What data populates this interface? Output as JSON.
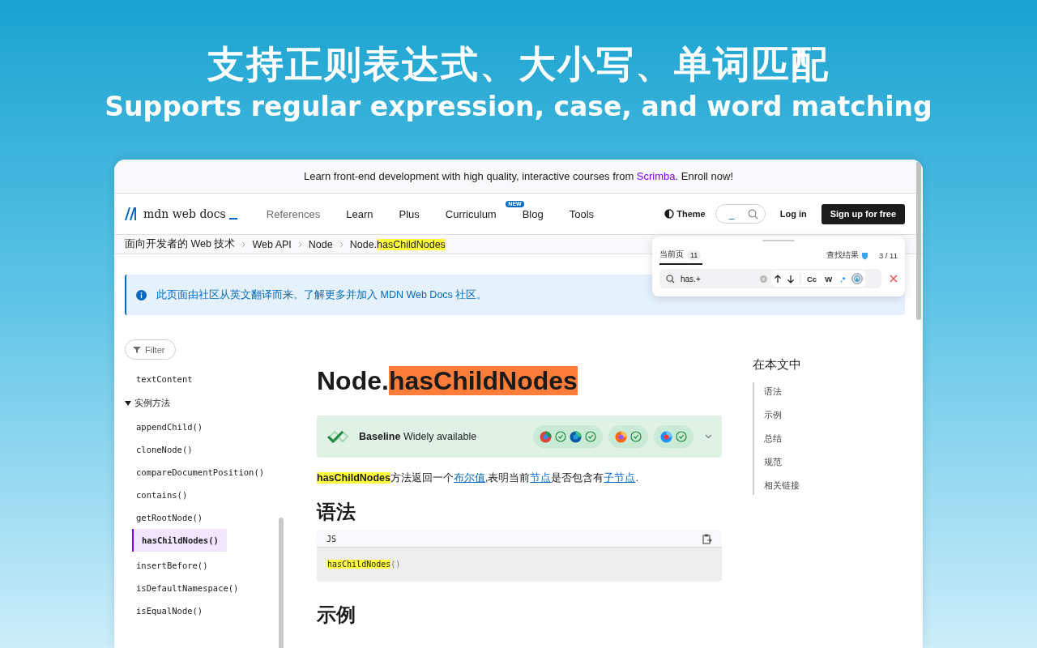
{
  "headline": {
    "title": "支持正则表达式、大小写、单词匹配",
    "subtitle": "Supports regular expression, case, and word matching"
  },
  "banner": {
    "before": "Learn front-end development with high quality, interactive courses from ",
    "link": "Scrimba",
    "after": ". Enroll now!"
  },
  "nav": {
    "logo": "mdn web docs",
    "links": [
      {
        "label": "References",
        "selected": true
      },
      {
        "label": "Learn",
        "selected": false
      },
      {
        "label": "Plus",
        "selected": false
      },
      {
        "label": "Curriculum",
        "selected": false,
        "badge": "NEW"
      },
      {
        "label": "Blog",
        "selected": false
      },
      {
        "label": "Tools",
        "selected": false
      }
    ],
    "theme": "Theme",
    "search_placeholder": "_",
    "login": "Log in",
    "signup": "Sign up for free"
  },
  "breadcrumbs": [
    {
      "text": "面向开发者的 Web 技术"
    },
    {
      "text": "Web API"
    },
    {
      "text": "Node"
    },
    {
      "text": "Node.",
      "match": "hasChildNodes"
    }
  ],
  "notice": "此页面由社区从英文翻译而来。了解更多并加入 MDN Web Docs 社区。",
  "sidebar": {
    "filter": "Filter",
    "items": [
      {
        "label": "textContent",
        "selected": false
      },
      {
        "label": "实例方法",
        "expanded": true,
        "children": [
          {
            "label": "appendChild()",
            "selected": false
          },
          {
            "label": "cloneNode()",
            "selected": false
          },
          {
            "label": "compareDocumentPosition()",
            "selected": false
          },
          {
            "label": "contains()",
            "selected": false
          },
          {
            "label": "getRootNode()",
            "selected": false
          },
          {
            "label": "hasChildNodes()",
            "selected": true
          },
          {
            "label": "insertBefore()",
            "selected": false
          },
          {
            "label": "isDefaultNamespace()",
            "selected": false
          },
          {
            "label": "isEqualNode()",
            "selected": false
          }
        ]
      }
    ]
  },
  "article": {
    "title": {
      "text": "Node.",
      "match": "hasChildNodes"
    },
    "baseline": {
      "bold": "Baseline",
      "text": "Widely available",
      "browser_groups": [
        [
          {
            "kind": "chrome"
          },
          {
            "kind": "edge"
          }
        ],
        [
          {
            "kind": "firefox"
          }
        ],
        [
          {
            "kind": "safari"
          }
        ]
      ]
    },
    "description": [
      {
        "kind": "match",
        "text": "hasChildNodes"
      },
      {
        "kind": "text",
        "text": "方法返回一个"
      },
      {
        "kind": "link",
        "text": "布尔值"
      },
      {
        "kind": "text",
        "text": ",表明当前"
      },
      {
        "kind": "link",
        "text": "节点"
      },
      {
        "kind": "text",
        "text": "是否包含有"
      },
      {
        "kind": "link",
        "text": "子节点"
      },
      {
        "kind": "text",
        "text": "."
      }
    ],
    "sections": [
      {
        "heading": "语法",
        "code": {
          "language": "JS",
          "match": "hasChildNodes",
          "rest": "()"
        }
      },
      {
        "heading": "示例"
      }
    ]
  },
  "toc": {
    "title": "在本文中",
    "items": [
      "语法",
      "示例",
      "总结",
      "规范",
      "相关链接"
    ]
  },
  "find_panel": {
    "tabs": [
      {
        "label": "当前页",
        "count": "11",
        "selected": true
      }
    ],
    "results_label": "查找结果",
    "results": "3 / 11",
    "query": "has.+",
    "options": [
      {
        "label": "Cc",
        "on": false
      },
      {
        "label": "W",
        "on": false
      },
      {
        "label": ".*",
        "on": true
      }
    ]
  }
}
